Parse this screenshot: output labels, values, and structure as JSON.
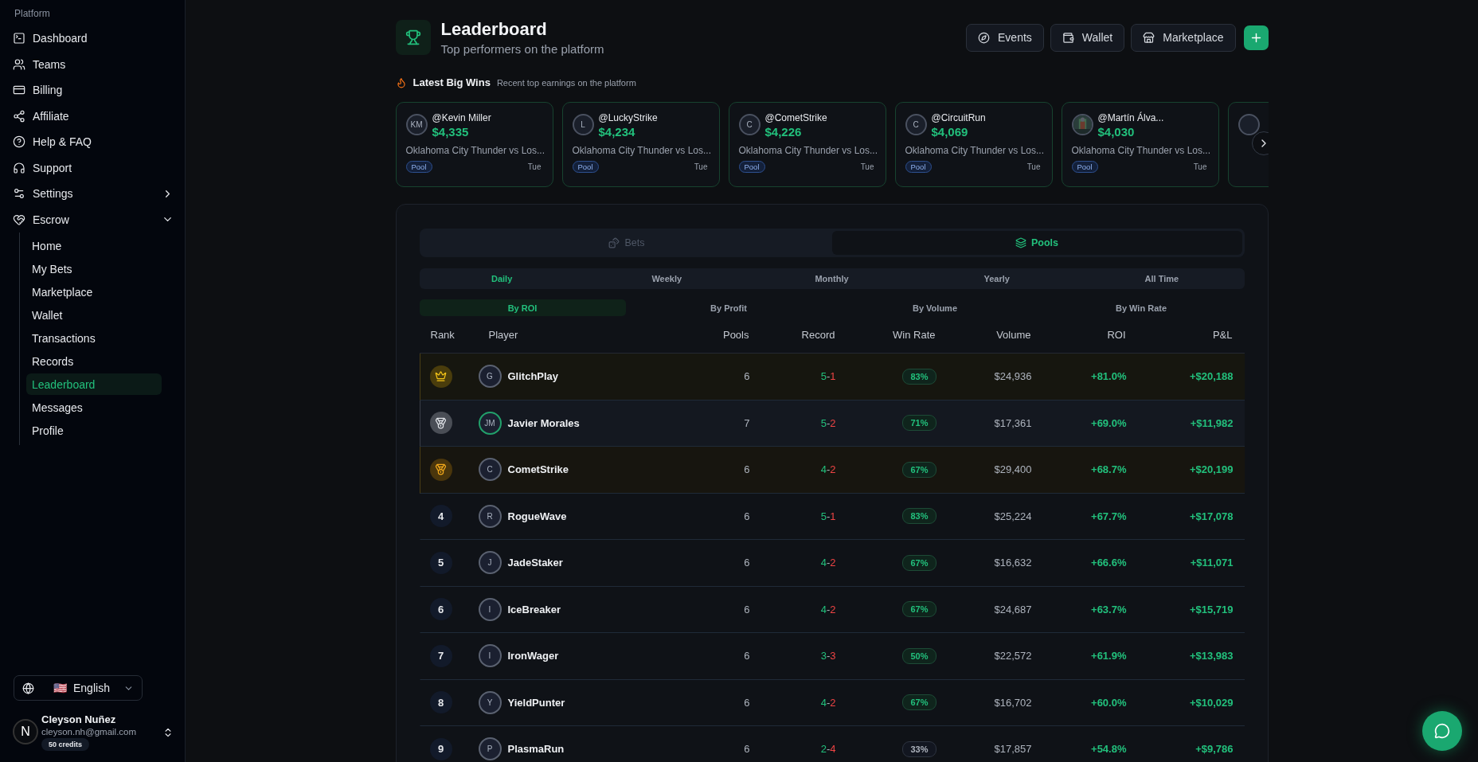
{
  "sidebar": {
    "section": "Platform",
    "items": [
      {
        "label": "Dashboard"
      },
      {
        "label": "Teams"
      },
      {
        "label": "Billing"
      },
      {
        "label": "Affiliate"
      },
      {
        "label": "Help & FAQ"
      },
      {
        "label": "Support"
      },
      {
        "label": "Settings",
        "expanded": false
      },
      {
        "label": "Escrow",
        "expanded": true,
        "children": [
          {
            "label": "Home",
            "selected": false
          },
          {
            "label": "My Bets",
            "selected": false
          },
          {
            "label": "Marketplace",
            "selected": false
          },
          {
            "label": "Wallet",
            "selected": false
          },
          {
            "label": "Transactions",
            "selected": false
          },
          {
            "label": "Records",
            "selected": false
          },
          {
            "label": "Leaderboard",
            "selected": true
          },
          {
            "label": "Messages",
            "selected": false
          },
          {
            "label": "Profile",
            "selected": false
          }
        ]
      }
    ],
    "language": {
      "flag": "🇺🇸",
      "label": "English"
    },
    "user": {
      "initial": "N",
      "name": "Cleyson Nuñez",
      "email": "cleyson.nh@gmail.com",
      "credits": "50 credits"
    }
  },
  "header": {
    "title": "Leaderboard",
    "subtitle": "Top performers on the platform",
    "buttons": [
      {
        "label": "Events"
      },
      {
        "label": "Wallet"
      },
      {
        "label": "Marketplace"
      }
    ]
  },
  "big_wins": {
    "title": "Latest Big Wins",
    "subtitle": "Recent top earnings on the platform",
    "cards": [
      {
        "initials": "KM",
        "handle": "@Kevin Miller",
        "amount": "$4,335",
        "match": "Oklahoma City Thunder vs Los...",
        "tag": "Pool",
        "day": "Tue"
      },
      {
        "initials": "L",
        "handle": "@LuckyStrike",
        "amount": "$4,234",
        "match": "Oklahoma City Thunder vs Los...",
        "tag": "Pool",
        "day": "Tue"
      },
      {
        "initials": "C",
        "handle": "@CometStrike",
        "amount": "$4,226",
        "match": "Oklahoma City Thunder vs Los...",
        "tag": "Pool",
        "day": "Tue"
      },
      {
        "initials": "C",
        "handle": "@CircuitRun",
        "amount": "$4,069",
        "match": "Oklahoma City Thunder vs Los...",
        "tag": "Pool",
        "day": "Tue"
      },
      {
        "kind": "picture",
        "handle": "@Martín Álva...",
        "amount": "$4,030",
        "match": "Oklahoma City Thunder vs Los...",
        "tag": "Pool",
        "day": "Tue"
      }
    ]
  },
  "mode_tabs": [
    {
      "label": "Bets",
      "selected": false
    },
    {
      "label": "Pools",
      "selected": true
    }
  ],
  "periods": [
    {
      "label": "Daily",
      "selected": true
    },
    {
      "label": "Weekly",
      "selected": false
    },
    {
      "label": "Monthly",
      "selected": false
    },
    {
      "label": "Yearly",
      "selected": false
    },
    {
      "label": "All Time",
      "selected": false
    }
  ],
  "sorts": [
    {
      "label": "By ROI",
      "selected": true
    },
    {
      "label": "By Profit",
      "selected": false
    },
    {
      "label": "By Volume",
      "selected": false
    },
    {
      "label": "By Win Rate",
      "selected": false
    }
  ],
  "table": {
    "columns": [
      "Rank",
      "Player",
      "Pools",
      "Record",
      "Win Rate",
      "Volume",
      "ROI",
      "P&L"
    ],
    "rows": [
      {
        "kind": "gold",
        "initials": "G",
        "player": "GlitchPlay",
        "pools": "6",
        "wins": "5",
        "dash": "-",
        "losses": "1",
        "win_rate": "83%",
        "low": false,
        "volume": "$24,936",
        "roi": "+81.0%",
        "pnl": "+$20,188"
      },
      {
        "kind": "silver",
        "initials": "JM",
        "player": "Javier Morales",
        "pools": "7",
        "wins": "5",
        "dash": "-",
        "losses": "2",
        "win_rate": "71%",
        "low": false,
        "volume": "$17,361",
        "roi": "+69.0%",
        "pnl": "+$11,982"
      },
      {
        "kind": "bronze",
        "initials": "C",
        "player": "CometStrike",
        "pools": "6",
        "wins": "4",
        "dash": "-",
        "losses": "2",
        "win_rate": "67%",
        "low": false,
        "volume": "$29,400",
        "roi": "+68.7%",
        "pnl": "+$20,199"
      },
      {
        "kind": "number",
        "rank": "4",
        "initials": "R",
        "player": "RogueWave",
        "pools": "6",
        "wins": "5",
        "dash": "-",
        "losses": "1",
        "win_rate": "83%",
        "low": false,
        "volume": "$25,224",
        "roi": "+67.7%",
        "pnl": "+$17,078"
      },
      {
        "kind": "number",
        "rank": "5",
        "initials": "J",
        "player": "JadeStaker",
        "pools": "6",
        "wins": "4",
        "dash": "-",
        "losses": "2",
        "win_rate": "67%",
        "low": false,
        "volume": "$16,632",
        "roi": "+66.6%",
        "pnl": "+$11,071"
      },
      {
        "kind": "number",
        "rank": "6",
        "initials": "I",
        "player": "IceBreaker",
        "pools": "6",
        "wins": "4",
        "dash": "-",
        "losses": "2",
        "win_rate": "67%",
        "low": false,
        "volume": "$24,687",
        "roi": "+63.7%",
        "pnl": "+$15,719"
      },
      {
        "kind": "number",
        "rank": "7",
        "initials": "I",
        "player": "IronWager",
        "pools": "6",
        "wins": "3",
        "dash": "-",
        "losses": "3",
        "win_rate": "50%",
        "low": false,
        "volume": "$22,572",
        "roi": "+61.9%",
        "pnl": "+$13,983"
      },
      {
        "kind": "number",
        "rank": "8",
        "initials": "Y",
        "player": "YieldPunter",
        "pools": "6",
        "wins": "4",
        "dash": "-",
        "losses": "2",
        "win_rate": "67%",
        "low": false,
        "volume": "$16,702",
        "roi": "+60.0%",
        "pnl": "+$10,029"
      },
      {
        "kind": "number",
        "rank": "9",
        "initials": "P",
        "player": "PlasmaRun",
        "pools": "6",
        "wins": "2",
        "dash": "-",
        "losses": "4",
        "win_rate": "33%",
        "low": true,
        "volume": "$17,857",
        "roi": "+54.8%",
        "pnl": "+$9,786"
      }
    ]
  }
}
